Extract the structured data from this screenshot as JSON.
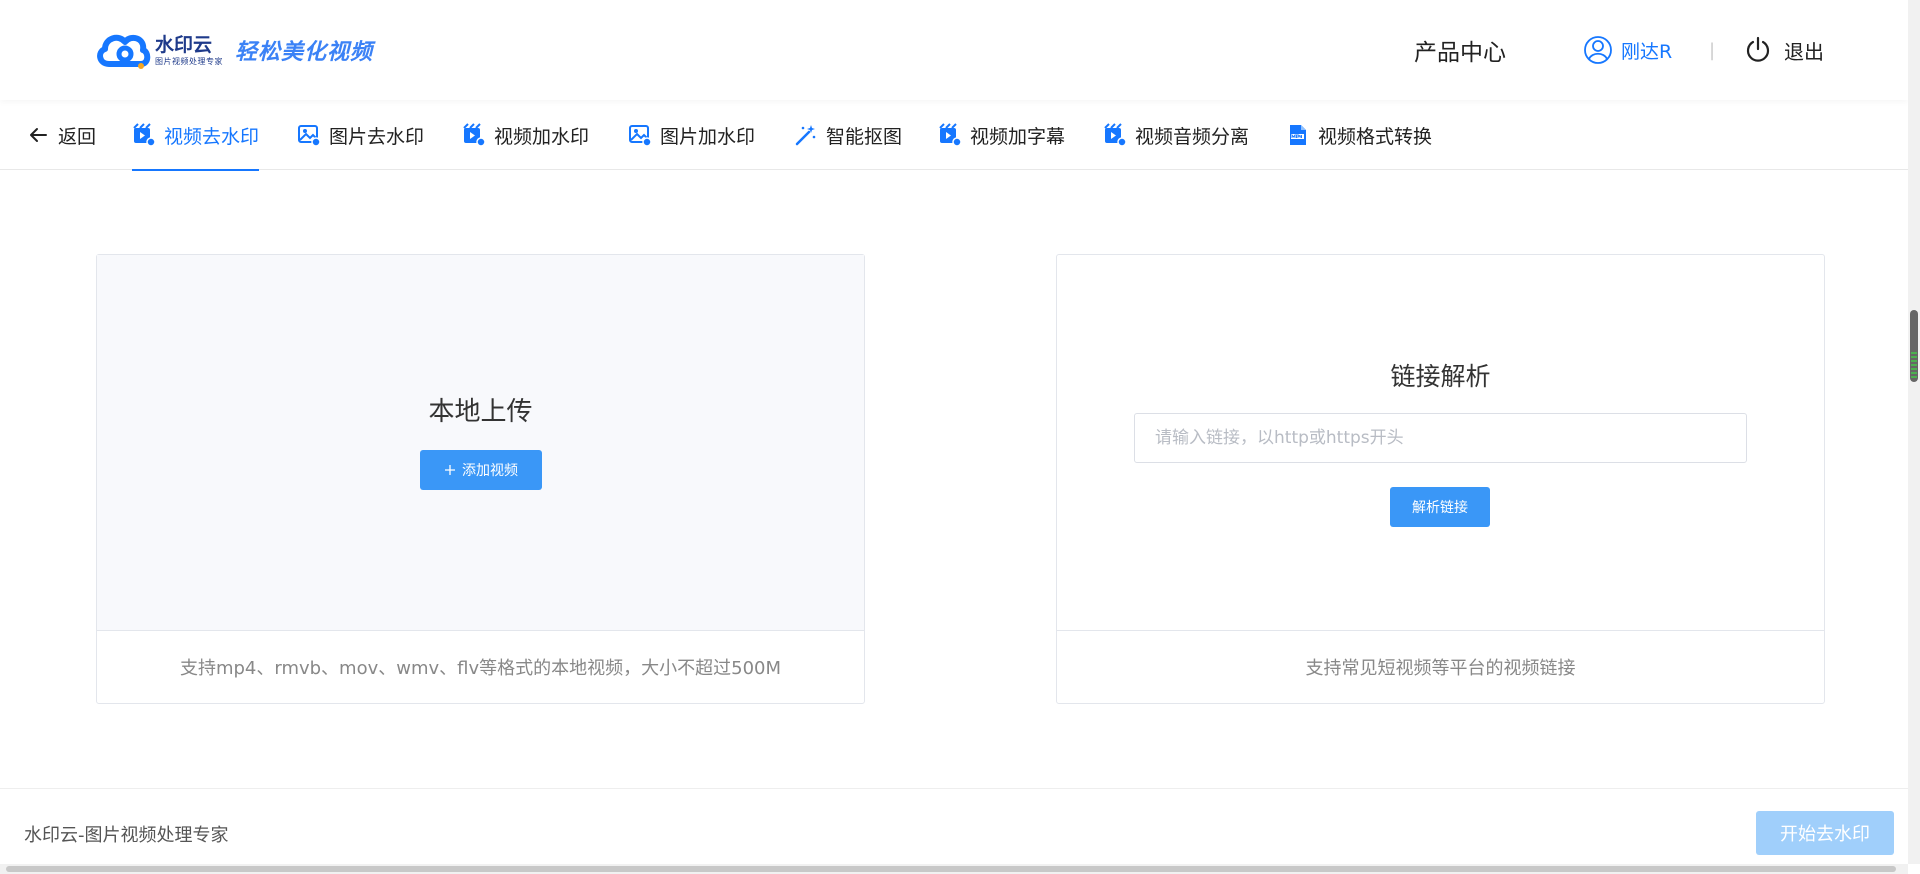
{
  "header": {
    "brand_name": "水印云",
    "brand_sub": "图片视频处理专家",
    "slogan": "轻松美化视频",
    "product_center": "产品中心",
    "username": "刚达R",
    "separator": "|",
    "logout": "退出"
  },
  "tabs": {
    "back": "返回",
    "items": [
      {
        "label": "视频去水印",
        "icon": "video-remove-watermark-icon",
        "active": true
      },
      {
        "label": "图片去水印",
        "icon": "image-remove-watermark-icon"
      },
      {
        "label": "视频加水印",
        "icon": "video-add-watermark-icon"
      },
      {
        "label": "图片加水印",
        "icon": "image-add-watermark-icon"
      },
      {
        "label": "智能抠图",
        "icon": "magic-wand-icon"
      },
      {
        "label": "视频加字幕",
        "icon": "video-subtitle-icon"
      },
      {
        "label": "视频音频分离",
        "icon": "video-audio-split-icon"
      },
      {
        "label": "视频格式转换",
        "icon": "mp4-file-icon"
      }
    ]
  },
  "local_upload": {
    "title": "本地上传",
    "button": "添加视频",
    "note": "支持mp4、rmvb、mov、wmv、flv等格式的本地视频，大小不超过500M"
  },
  "link_parse": {
    "title": "链接解析",
    "placeholder": "请输入链接，以http或https开头",
    "value": "",
    "button": "解析链接",
    "note": "支持常见短视频等平台的视频链接"
  },
  "footer": {
    "text": "水印云-图片视频处理专家",
    "start_button": "开始去水印"
  },
  "colors": {
    "accent": "#1677ff",
    "button": "#3a97f7",
    "button_disabled": "#a0cffb"
  }
}
